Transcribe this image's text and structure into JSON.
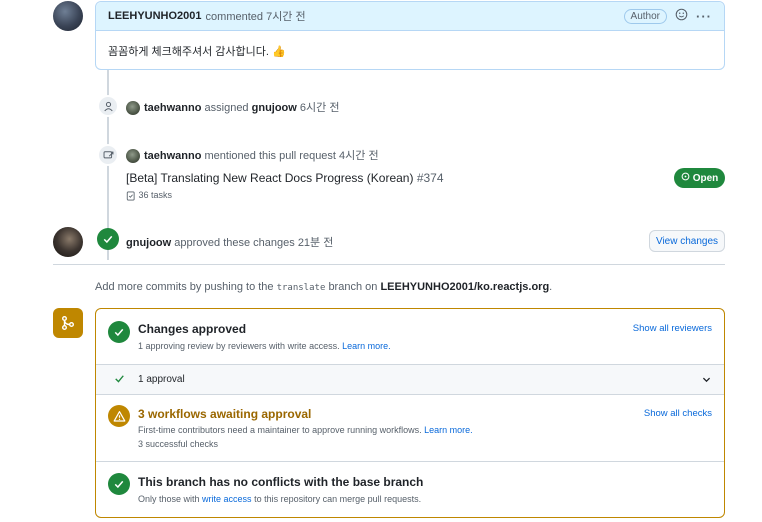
{
  "comment": {
    "author": "LEEHYUNHO2001",
    "action": "commented 7시간 전",
    "badge": "Author",
    "body": "꼼꼼하게 체크해주셔서 감사합니다.",
    "emoji": "👍"
  },
  "events": {
    "assigned": {
      "actor": "taehwanno",
      "verb": "assigned",
      "target": "gnujoow",
      "time": "6시간 전"
    },
    "mentioned": {
      "actor": "taehwanno",
      "text": "mentioned this pull request 4시간 전",
      "ref_title": "[Beta] Translating New React Docs Progress (Korean)",
      "ref_number": "#374",
      "tasks": "36 tasks",
      "status": "Open"
    },
    "approved": {
      "actor": "gnujoow",
      "text": "approved these changes 21분 전",
      "button": "View changes"
    }
  },
  "push_note": {
    "prefix": "Add more commits by pushing to the",
    "branch": "translate",
    "middle": "branch on",
    "repo": "LEEHYUNHO2001/ko.reactjs.org",
    "suffix": "."
  },
  "merge": {
    "changes": {
      "title": "Changes approved",
      "sub": "1 approving review by reviewers with write access.",
      "learn": "Learn more.",
      "link": "Show all reviewers"
    },
    "approval_row": {
      "label": "1 approval"
    },
    "workflows": {
      "title": "3 workflows awaiting approval",
      "sub1": "First-time contributors need a maintainer to approve running workflows.",
      "learn": "Learn more.",
      "sub2": "3 successful checks",
      "link": "Show all checks"
    },
    "conflicts": {
      "title": "This branch has no conflicts with the base branch",
      "sub_prefix": "Only those with",
      "sub_link": "write access",
      "sub_suffix": "to this repository can merge pull requests."
    }
  },
  "colors": {
    "success": "#1f883d",
    "attention": "#bf8700",
    "accent": "#0969da"
  },
  "icons": [
    "person-icon",
    "cross-reference-icon",
    "check-icon",
    "git-merge-icon",
    "alert-icon",
    "smiley-icon",
    "kebab-icon",
    "chevron-down-icon"
  ]
}
